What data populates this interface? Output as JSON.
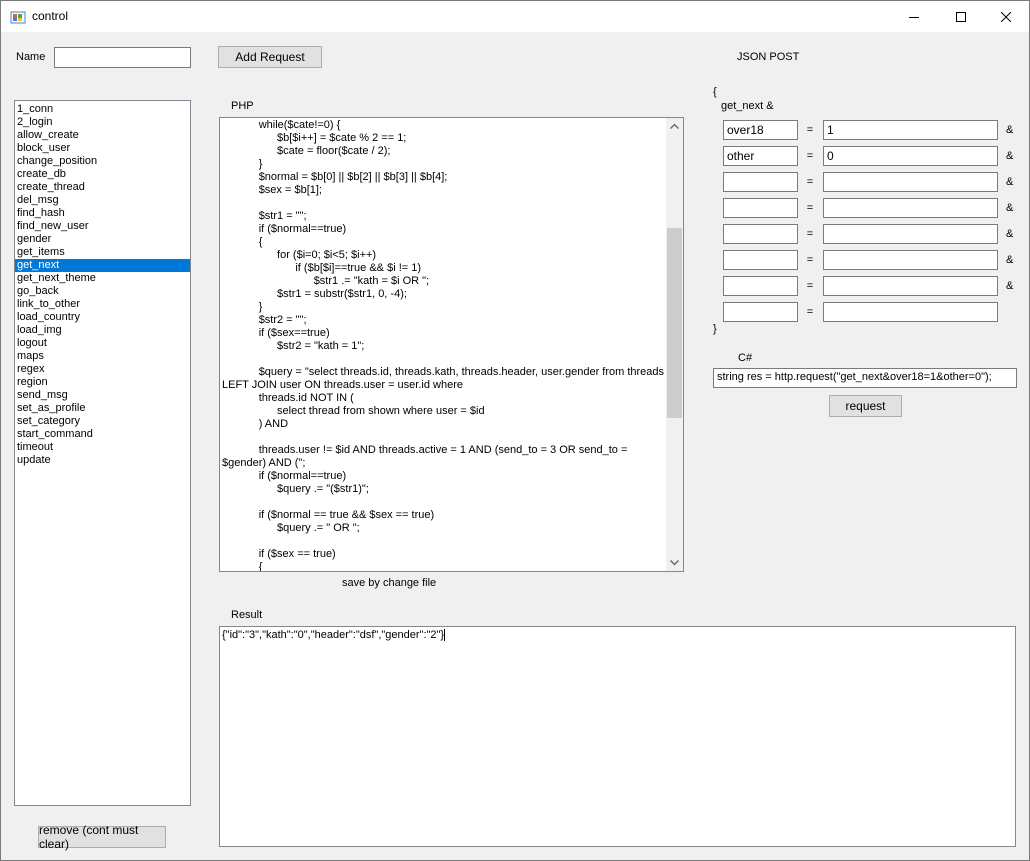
{
  "window": {
    "title": "control"
  },
  "name_field": {
    "label": "Name",
    "value": ""
  },
  "add_request_label": "Add Request",
  "json_post_label": "JSON POST",
  "php_label": "PHP",
  "save_label": "save by change file",
  "result_label": "Result",
  "remove_label": "remove (cont must clear)",
  "request_label": "request",
  "csharp_label": "C#",
  "csharp_code": "string res = http.request(\"get_next&over18=1&other=0\");",
  "result_text": "{\"id\":\"3\",\"kath\":\"0\",\"header\":\"dsf\",\"gender\":\"2\"}",
  "json": {
    "open_brace": "{",
    "close_brace": "}",
    "method_line": "get_next &",
    "equals": "=",
    "ampersand": "&",
    "params": [
      {
        "key": "over18",
        "value": "1"
      },
      {
        "key": "other",
        "value": "0"
      },
      {
        "key": "",
        "value": ""
      },
      {
        "key": "",
        "value": ""
      },
      {
        "key": "",
        "value": ""
      },
      {
        "key": "",
        "value": ""
      },
      {
        "key": "",
        "value": ""
      },
      {
        "key": "",
        "value": ""
      }
    ]
  },
  "requests": [
    "1_conn",
    "2_login",
    "allow_create",
    "block_user",
    "change_position",
    "create_db",
    "create_thread",
    "del_msg",
    "find_hash",
    "find_new_user",
    "gender",
    "get_items",
    "get_next",
    "get_next_theme",
    "go_back",
    "link_to_other",
    "load_country",
    "load_img",
    "logout",
    "maps",
    "regex",
    "region",
    "send_msg",
    "set_as_profile",
    "set_category",
    "start_command",
    "timeout",
    "update"
  ],
  "selected_request": "get_next",
  "php_lines": [
    "\t\twhile($cate!=0) {",
    "\t\t\t$b[$i++] = $cate % 2 == 1;",
    "\t\t\t$cate = floor($cate / 2);",
    "\t\t}",
    "\t\t$normal = $b[0] || $b[2] || $b[3] || $b[4];",
    "\t\t$sex = $b[1];",
    "",
    "\t\t$str1 = \"\";",
    "\t\tif ($normal==true)",
    "\t\t{",
    "\t\t\tfor ($i=0; $i<5; $i++)",
    "\t\t\t\tif ($b[$i]==true && $i != 1)",
    "\t\t\t\t\t$str1 .= \"kath = $i OR \";",
    "\t\t\t$str1 = substr($str1, 0, -4);",
    "\t\t}",
    "\t\t$str2 = \"\";",
    "\t\tif ($sex==true)",
    "\t\t\t$str2 = \"kath = 1\";",
    "",
    "\t\t$query = \"select threads.id, threads.kath, threads.header, user.gender from threads",
    "LEFT JOIN user ON threads.user = user.id where",
    "\t\tthreads.id NOT IN (",
    "\t\t\tselect thread from shown where user = $id",
    "\t\t) AND",
    "",
    "\t\tthreads.user != $id AND threads.active = 1 AND (send_to = 3 OR send_to =",
    "$gender) AND (\";",
    "\t\tif ($normal==true)",
    "\t\t\t$query .= \"($str1)\";",
    "",
    "\t\tif ($normal == true && $sex == true)",
    "\t\t\t$query .= \" OR \";",
    "",
    "\t\tif ($sex == true)",
    "\t\t{"
  ],
  "icons": [
    "app-icon",
    "minimize-icon",
    "maximize-icon",
    "close-icon",
    "scroll-up-icon",
    "scroll-down-icon"
  ]
}
